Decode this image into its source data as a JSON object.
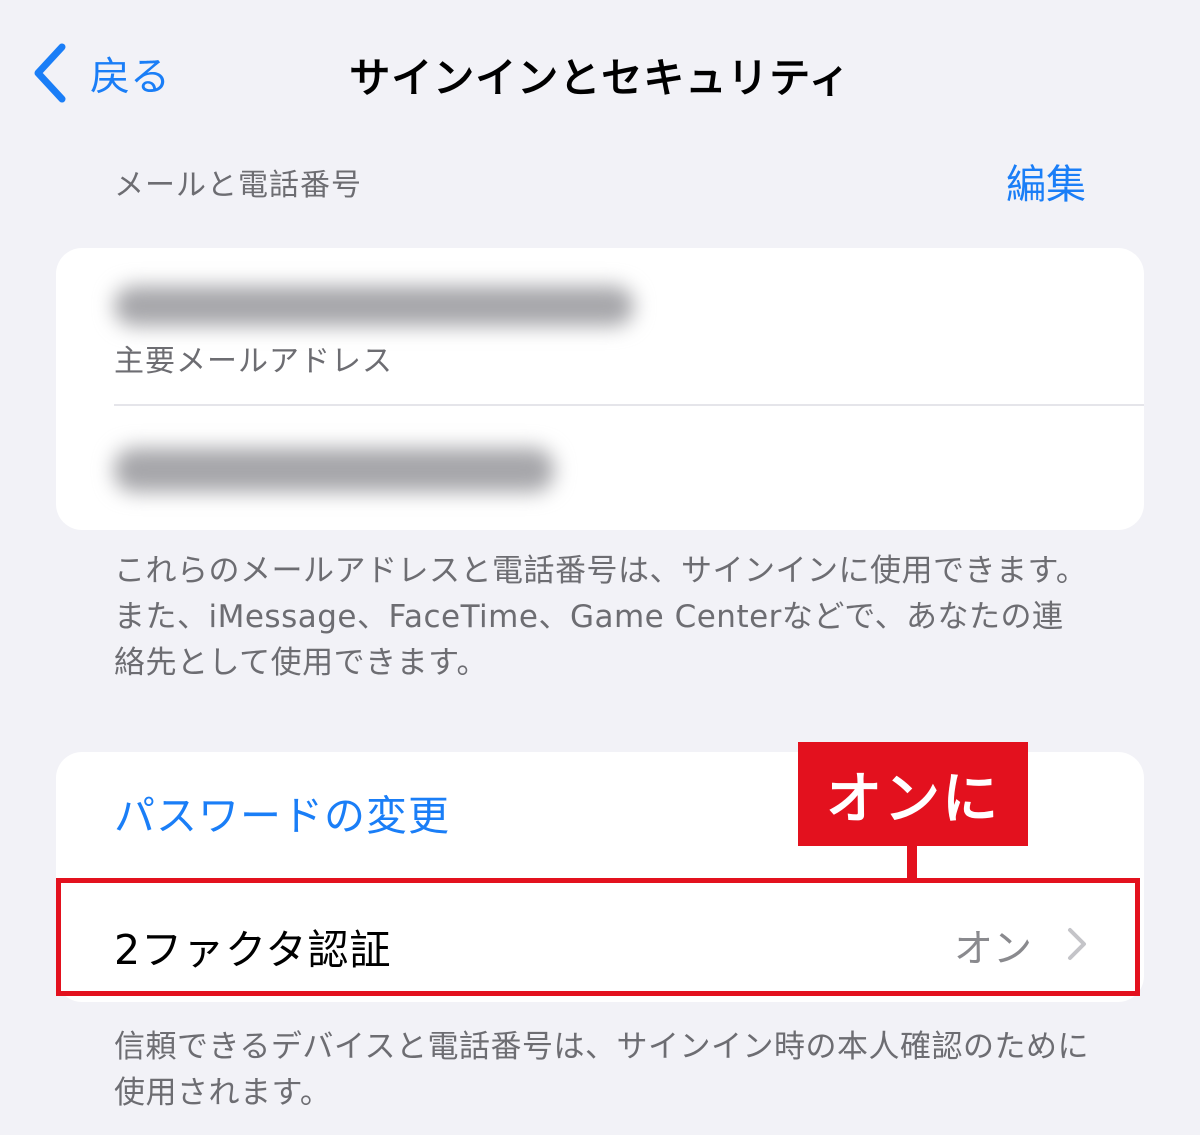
{
  "nav": {
    "back_label": "戻る",
    "title": "サインインとセキュリティ"
  },
  "email_section": {
    "header": "メールと電話番号",
    "edit_label": "編集",
    "primary_email_label": "主要メールアドレス",
    "footer": "これらのメールアドレスと電話番号は、サインインに使用できます。また、iMessage、FaceTime、Game Centerなどで、あなたの連絡先として使用できます。"
  },
  "security_section": {
    "change_password_label": "パスワードの変更",
    "two_factor_label": "2ファクタ認証",
    "two_factor_value": "オン",
    "footer": "信頼できるデバイスと電話番号は、サインイン時の本人確認のために使用されます。"
  },
  "annotation": {
    "callout_text": "オンに",
    "color": "#e3111e"
  },
  "colors": {
    "accent": "#1a7ef7",
    "background": "#f2f2f7",
    "secondary_text": "#6d6d72"
  },
  "icons": {
    "back": "chevron-left-icon",
    "disclosure": "chevron-right-icon"
  }
}
